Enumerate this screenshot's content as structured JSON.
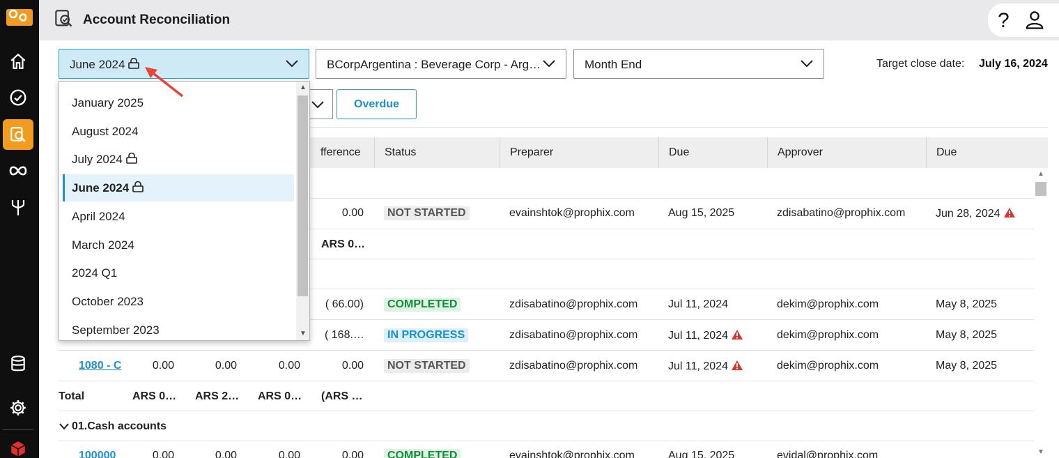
{
  "header": {
    "title": "Account Reconciliation"
  },
  "filters": {
    "period": "June 2024",
    "entity": "BCorpArgentina : Beverage Corp - Argentina",
    "close_type": "Month End",
    "target_label": "Target close date:",
    "target_value": "July 16, 2024",
    "overdue_label": "Overdue"
  },
  "period_options": [
    {
      "label": "January 2025",
      "locked": false
    },
    {
      "label": "August 2024",
      "locked": false
    },
    {
      "label": "July 2024",
      "locked": true
    },
    {
      "label": "June 2024",
      "locked": true,
      "selected": true
    },
    {
      "label": "April 2024",
      "locked": false
    },
    {
      "label": "March 2024",
      "locked": false
    },
    {
      "label": "2024 Q1",
      "locked": false
    },
    {
      "label": "October 2023",
      "locked": false
    },
    {
      "label": "September 2023",
      "locked": false
    }
  ],
  "columns": {
    "difference": "fference",
    "status": "Status",
    "preparer": "Preparer",
    "due1": "Due",
    "approver": "Approver",
    "due2": "Due"
  },
  "rows": [
    {
      "diff": "0.00",
      "status": "NOT STARTED",
      "preparer": "evainshtok@prophix.com",
      "due1": "Aug 15, 2025",
      "approver": "zdisabatino@prophix.com",
      "due2": "Jun 28, 2024"
    },
    {
      "subtotal": "ARS 0…"
    },
    {
      "diff": "( 66.00)",
      "status": "COMPLETED",
      "preparer": "zdisabatino@prophix.com",
      "due1": "Jul 11, 2024",
      "approver": "dekim@prophix.com",
      "due2": "May 8, 2025"
    },
    {
      "diff": "( 168.…",
      "status": "IN PROGRESS",
      "preparer": "zdisabatino@prophix.com",
      "due1": "Jul 11, 2024",
      "approver": "dekim@prophix.com",
      "due2": "May 8, 2025"
    },
    {
      "account": "1080 - C",
      "c1": "0.00",
      "c2": "0.00",
      "c3": "0.00",
      "diff": "0.00",
      "status": "NOT STARTED",
      "preparer": "zdisabatino@prophix.com",
      "due1": "Jul 11, 2024",
      "approver": "dekim@prophix.com",
      "due2": "May 8, 2025"
    }
  ],
  "total_row": {
    "label": "Total",
    "c1": "ARS 0…",
    "c2": "ARS 2…",
    "c3": "ARS 0…",
    "diff": "(ARS …"
  },
  "group": {
    "label": "01.Cash accounts"
  },
  "last_row": {
    "account": "100000",
    "c1": "0.00",
    "c2": "0.00",
    "c3": "0.00",
    "diff": "0.00",
    "status": "COMPLETED",
    "preparer": "evainshtok@prophix.com",
    "due1": "Aug 15, 2025",
    "approver": "evidal@prophix.com"
  },
  "colors": {
    "accent": "#f29c1f",
    "link": "#1f8fd1",
    "warning": "#e03131"
  }
}
